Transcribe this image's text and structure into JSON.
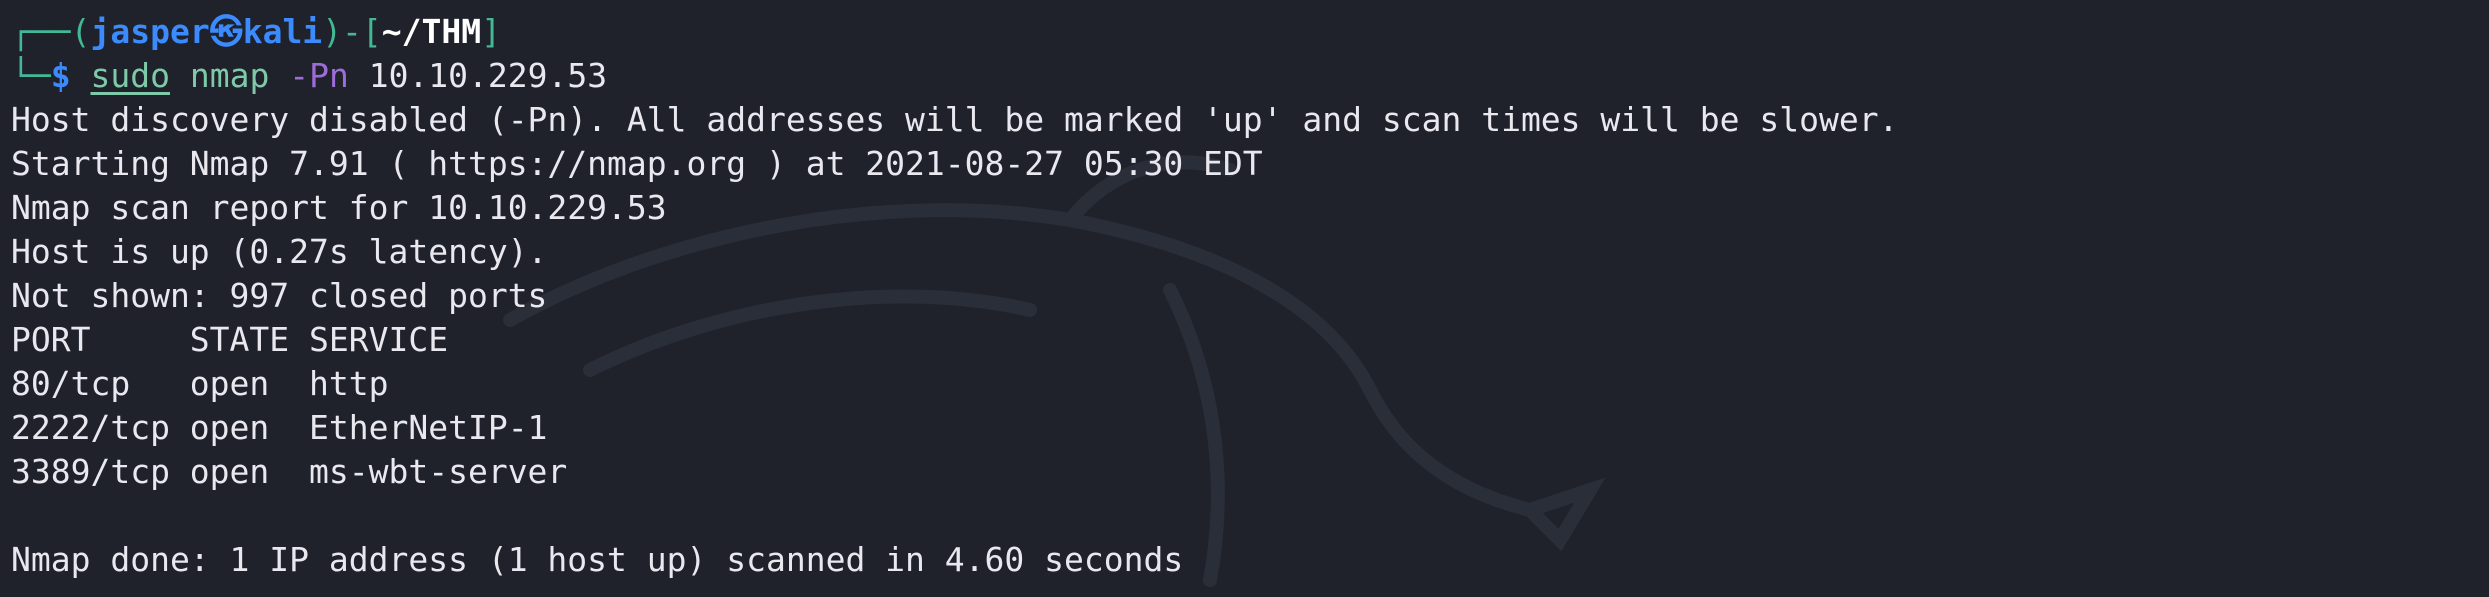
{
  "prompt": {
    "corner_top": "┌──(",
    "user": "jasper",
    "at_symbol": "㉿",
    "host": "kali",
    "mid": ")-[",
    "cwd": "~/THM",
    "end": "]",
    "corner_bottom": "└─",
    "dollar": "$"
  },
  "command": {
    "sudo": "sudo",
    "program": "nmap",
    "flag": "-Pn",
    "target": "10.10.229.53"
  },
  "output": {
    "lines": [
      "Host discovery disabled (-Pn). All addresses will be marked 'up' and scan times will be slower.",
      "Starting Nmap 7.91 ( https://nmap.org ) at 2021-08-27 05:30 EDT",
      "Nmap scan report for 10.10.229.53",
      "Host is up (0.27s latency).",
      "Not shown: 997 closed ports",
      "PORT     STATE SERVICE",
      "80/tcp   open  http",
      "2222/tcp open  EtherNetIP-1",
      "3389/tcp open  ms-wbt-server",
      "",
      "Nmap done: 1 IP address (1 host up) scanned in 4.60 seconds"
    ]
  },
  "colors": {
    "background": "#1f222b",
    "prompt_frame": "#43b894",
    "user_host": "#3b8bff",
    "command": "#7ec9a8",
    "flag": "#9e6cd8",
    "text": "#e8e8ee"
  }
}
